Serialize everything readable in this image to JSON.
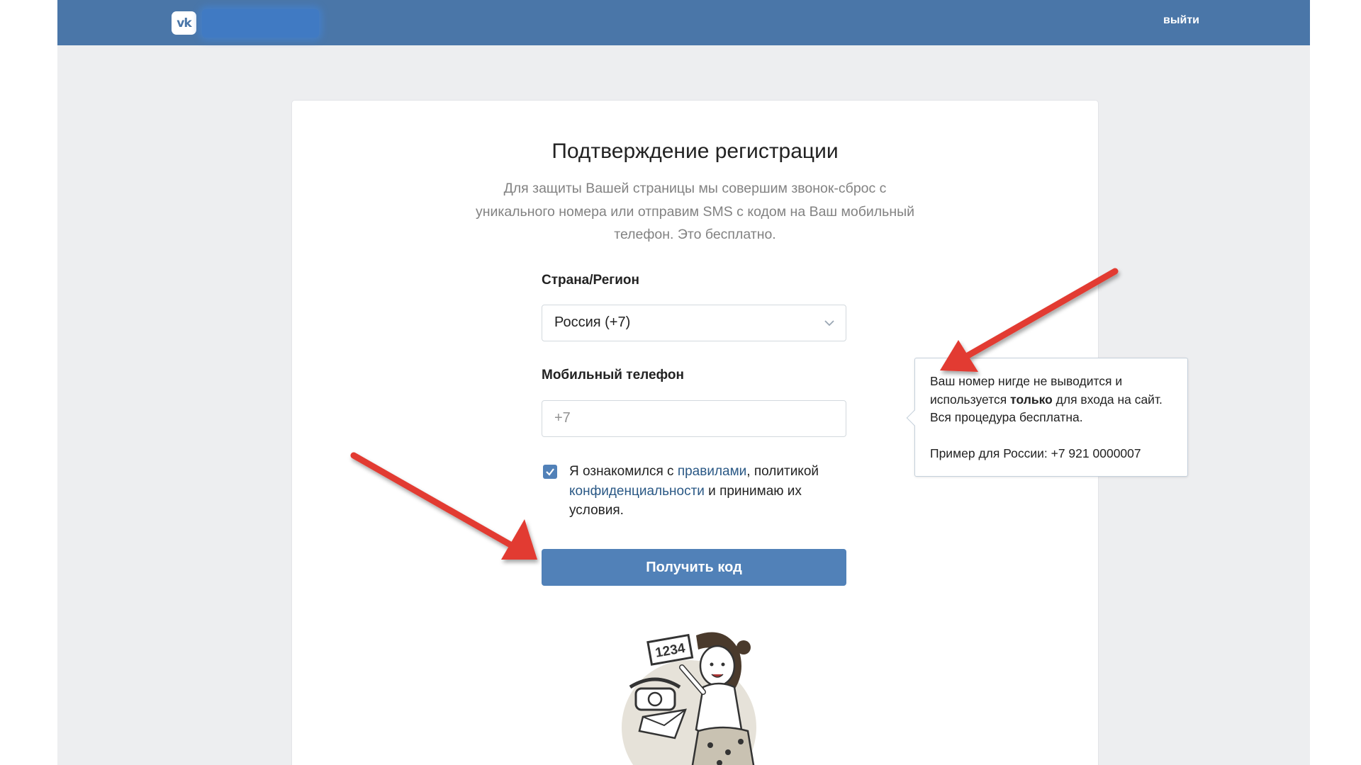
{
  "header": {
    "logo_text": "vk",
    "logout_label": "выйти"
  },
  "card": {
    "title": "Подтверждение регистрации",
    "description": "Для защиты Вашей страницы мы совершим звонок-сброс с уникального номера или отправим SMS с кодом на Ваш мобильный телефон. Это бесплатно.",
    "country_label": "Страна/Регион",
    "country_value": "Россия (+7)",
    "phone_label": "Мобильный телефон",
    "phone_prefix": "+7",
    "agree_checked": true,
    "agree_part1": "Я ознакомился с ",
    "agree_link_rules": "правилами",
    "agree_part2": ", политикой ",
    "agree_link_privacy": "конфиденциальности",
    "agree_part3": " и принимаю их условия.",
    "submit_label": "Получить код",
    "illustration_code": "1234"
  },
  "tooltip": {
    "line1_pre": "Ваш номер нигде не выводится и используется ",
    "line1_bold": "только",
    "line1_post": " для входа на сайт. Вся процедура бесплатна.",
    "example": "Пример для России: +7 921 0000007"
  },
  "colors": {
    "header_bg": "#4a76a8",
    "accent": "#5181b8",
    "link": "#2a5885",
    "annotation_arrow": "#e23b30"
  }
}
